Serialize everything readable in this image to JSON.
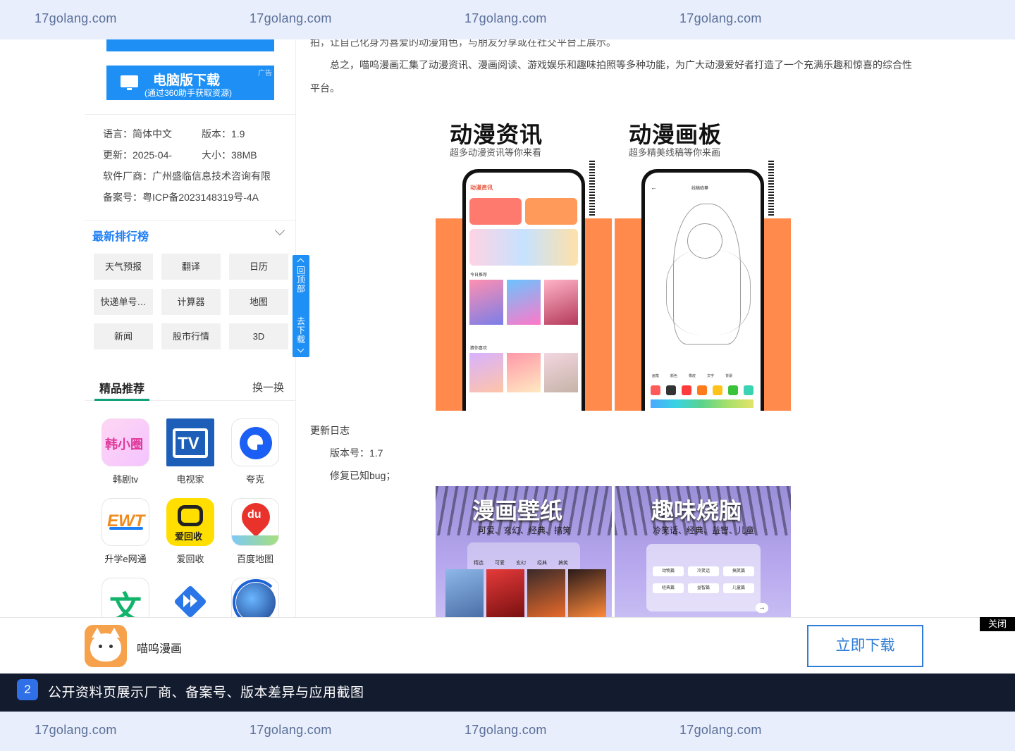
{
  "watermark": {
    "text": "17golang.com"
  },
  "sidebar": {
    "pc_download": {
      "title": "电脑版下载",
      "subtitle": "(通过360助手获取资源)",
      "ad_label": "广告"
    },
    "info": {
      "language": "语言：简体中文",
      "version": "版本：1.9",
      "updated": "更新：2025-04-",
      "size": "大小：38MB",
      "vendor": "软件厂商：广州盛临信息技术咨询有限",
      "icp": "备案号：粤ICP备2023148319号-4A"
    },
    "ranking": {
      "title": "最新排行榜",
      "tags": [
        "天气预报",
        "翻译",
        "日历",
        "快递单号…",
        "计算器",
        "地图",
        "新闻",
        "股市行情",
        "3D"
      ]
    },
    "featured": {
      "title": "精品推荐",
      "switch_label": "换一换",
      "apps": [
        {
          "name": "韩剧tv",
          "icon": "hanxiaoquan-icon",
          "icon_text": "韩小圈"
        },
        {
          "name": "电视家",
          "icon": "tv-icon",
          "icon_text": "TV"
        },
        {
          "name": "夸克",
          "icon": "quark-icon"
        },
        {
          "name": "升学e网通",
          "icon": "ewt-icon",
          "icon_text": "EWT"
        },
        {
          "name": "爱回收",
          "icon": "aihuishou-icon",
          "icon_text": "爱回收"
        },
        {
          "name": "百度地图",
          "icon": "baidu-map-icon",
          "icon_text": "du"
        }
      ]
    },
    "float": {
      "top_label": "回顶部",
      "download_label": "去下载"
    }
  },
  "main": {
    "para_top": "拍，让自己化身为喜爱的动漫角色，与朋友分享或在社交平台上展示。",
    "para_summary_1": "总之，喵呜漫画汇集了动漫资讯、漫画阅读、游戏娱乐和趣味拍照等多种功能，为广大动漫爱好者打造了一个充满乐趣和惊喜的综合性",
    "para_summary_2": "平台。",
    "shot1": {
      "title": "动漫资讯",
      "subtitle": "超多动漫资讯等你来看",
      "app_header": "动漫资讯",
      "section_today": "今日推荐",
      "section_guess": "猜你喜欢"
    },
    "shot2": {
      "title": "动漫画板",
      "subtitle": "超多精美线稿等你来画",
      "app_header": "线稿临摹",
      "tools": [
        "画笔",
        "颜色",
        "橡皮",
        "文字",
        "背景"
      ]
    },
    "changelog": {
      "title": "更新日志",
      "version": "版本号：1.7",
      "note": "修复已知bug；"
    },
    "shot3": {
      "title": "漫画壁纸",
      "subtitle": "可爱、玄幻、经典、搞笑",
      "filters": [
        "精选",
        "可爱",
        "玄幻",
        "经典",
        "搞笑"
      ]
    },
    "shot4": {
      "title": "趣味烧脑",
      "subtitle": "冷笑话、经典、益智、儿童",
      "cats": [
        "动物篇",
        "冷笑话",
        "搞笑篇",
        "经典篇",
        "益智篇",
        "儿童篇"
      ]
    }
  },
  "bottom_bar": {
    "app_name": "喵呜漫画",
    "download_button": "立即下载",
    "close_label": "关闭"
  },
  "caption": {
    "number": "2",
    "text": "公开资料页展示厂商、备案号、版本差异与应用截图"
  },
  "colors": {
    "accent": "#1e90f5",
    "watermark_bg": "#e8eefb",
    "caption_bg": "#131b2e",
    "green": "#12a07a"
  }
}
